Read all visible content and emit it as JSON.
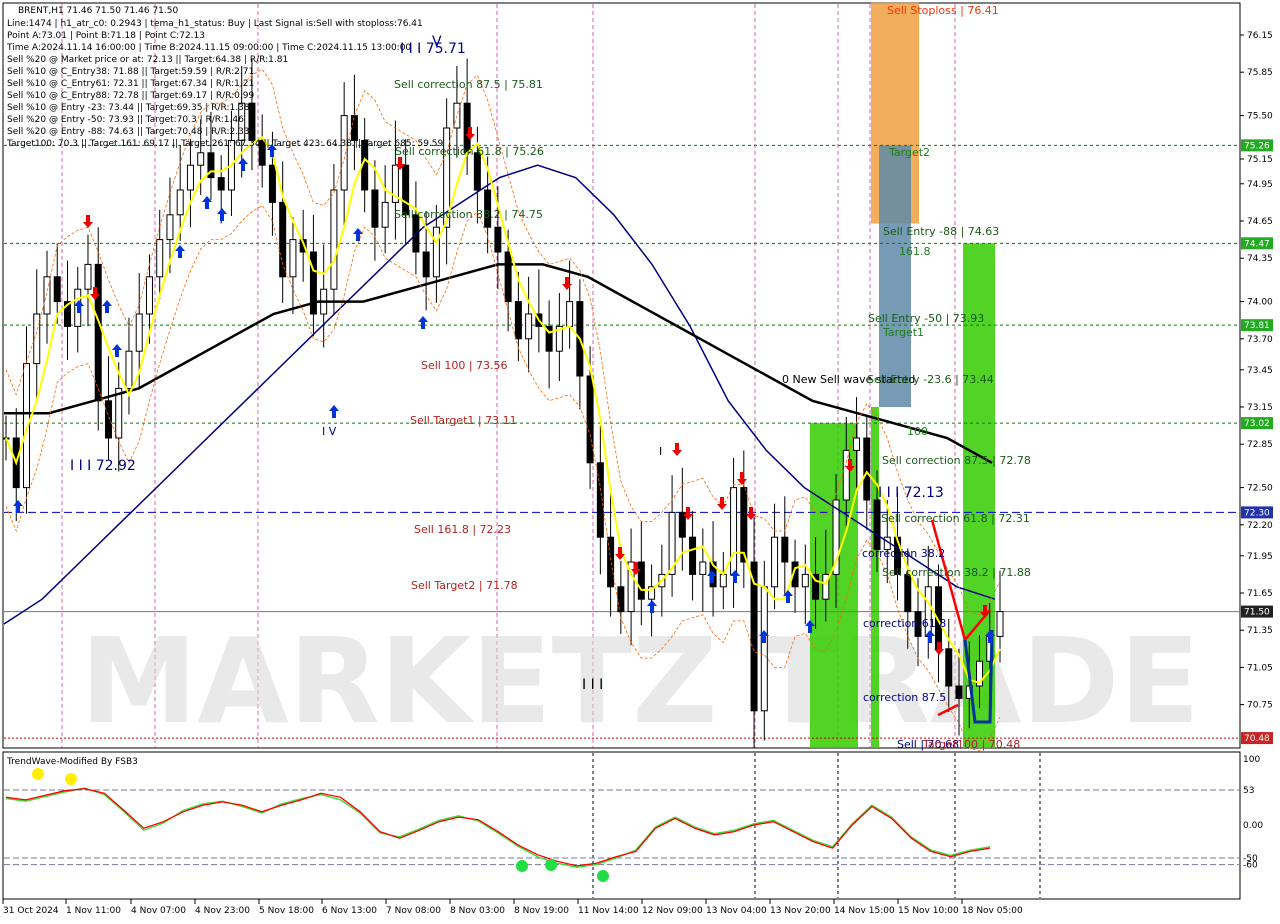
{
  "symbol_header": "BRENT,H1  71.46 71.50 71.46 71.50",
  "info_lines": [
    "Line:1474 | h1_atr_c0: 0.2943 | tema_h1_status: Buy | Last Signal is:Sell with stoploss:76.41",
    "Point A:73.01 | Point B:71.18 | Point C:72.13",
    "Time A:2024.11.14 16:00:00 | Time B:2024.11.15 09:00:00 | Time C:2024.11.15 13:00:00",
    "Sell %20 @ Market price or at: 72.13 || Target:64.38 | R/R:1.81",
    "Sell %10 @ C_Entry38: 71.88 || Target:59.59 | R/R:2.71",
    "Sell %10 @ C_Entry61: 72.31 || Target:67.34 | R/R:1.21",
    "Sell %10 @ C_Entry88: 72.78 || Target:69.17 | R/R:0.99",
    "Sell %10 @ Entry -23: 73.44 || Target:69.35 | R/R:1.38",
    "Sell %20 @ Entry -50: 73.93 || Target:70.3 | R/R:1.46",
    "Sell %20 @ Entry -88: 74.63 || Target:70.48 | R/R:2.33",
    "Target100: 70.3 || Target 161: 69.17 || Target 261: 67.34 || Target 423: 64.38 || Target 685: 59.59"
  ],
  "indicator_title": "TrendWave-Modified By FSB3",
  "watermark": "MARKETZ TRADE",
  "chart_labels": {
    "sell_stoploss": "Sell Stoploss | 76.41",
    "target2": "Target2",
    "sell_entry_88": "Sell Entry -88 | 74.63",
    "fib_1618": "161.8",
    "sell_entry_50": "Sell Entry -50 | 73.93",
    "target1": "Target1",
    "new_sell_wave": "0 New Sell wave started",
    "sell_entry_23": "Sell Entry -23.6 | 73.44",
    "fib_100": "100",
    "sell_corr_875_b": "Sell correction 87.5 | 72.78",
    "wave_iii_c": "I I I 72.13",
    "sell_corr_618_b": "Sell correction 61.8 | 72.31",
    "corr_382_short": "correction 38.2",
    "sell_corr_382_b": "Sell correction 38.2 | 71.88",
    "corr_618_short": "correction 61.8",
    "corr_875_short": "correction 87.5",
    "bottom_sell": "Sell | 70.68",
    "bottom_target": "Target100 | 70.48",
    "wave_iii_top": "I I I 75.71",
    "wave_v_top": "V",
    "sell_corr_875_a": "Sell correction 87.5 | 75.81",
    "sell_corr_618_a": "Sell correction 61.8 | 75.26",
    "sell_corr_382_a": "Sell correction 38.2 | 74.75",
    "sell_100": "Sell 100 | 73.56",
    "sell_target1": "Sell Target1 | 73.11",
    "sell_1618": "Sell 161.8 | 72.23",
    "sell_target2": "Sell Target2 | 71.78",
    "wave_iv": "I V",
    "wave_iii_left": "I I I 72.92",
    "wave_iii_mid": "I I I",
    "wave_i_mid": "I"
  },
  "colors": {
    "bull_candle": "#000000",
    "bear_candle": "#000000",
    "ema_fast": "#000080",
    "ema_slow": "#000000",
    "tema": "#ffff00",
    "envelope": "#ff6600",
    "sell_label": "#b22222",
    "green_zone": "#33cc00",
    "orange_zone": "#f0a040",
    "steelblue_zone": "#5f8aa8",
    "hline_green": "#008000",
    "hline_blue": "#0000cc",
    "osc_red": "#ff0000",
    "osc_green": "#33dd33"
  },
  "chart_data": {
    "type": "candlestick",
    "symbol": "BRENT",
    "timeframe": "H1",
    "ohlc_last": {
      "open": 71.46,
      "high": 71.5,
      "low": 71.46,
      "close": 71.5
    },
    "ylim": [
      70.4,
      76.4
    ],
    "price_ticks": [
      76.15,
      75.85,
      75.5,
      75.15,
      74.95,
      74.65,
      74.35,
      74.0,
      73.7,
      73.45,
      73.15,
      72.85,
      72.5,
      72.2,
      71.95,
      71.65,
      71.35,
      71.05,
      70.75
    ],
    "price_markers": [
      {
        "value": "75.26",
        "style": "green"
      },
      {
        "value": "74.47",
        "style": "green"
      },
      {
        "value": "73.81",
        "style": "green"
      },
      {
        "value": "73.02",
        "style": "green"
      },
      {
        "value": "72.30",
        "style": "blue"
      },
      {
        "value": "71.50",
        "style": "dark"
      },
      {
        "value": "70.48",
        "style": "red"
      }
    ],
    "h_levels": [
      {
        "value": 75.26,
        "style": "green_dotted"
      },
      {
        "value": 74.47,
        "style": "green_dotted"
      },
      {
        "value": 73.81,
        "style": "green_dotted"
      },
      {
        "value": 73.02,
        "style": "green_dotted"
      },
      {
        "value": 72.3,
        "style": "blue_dashed"
      },
      {
        "value": 71.5,
        "style": "gray_solid"
      },
      {
        "value": 70.48,
        "style": "red_dotted"
      }
    ],
    "x_labels": [
      "31 Oct 2024",
      "1 Nov 11:00",
      "4 Nov 07:00",
      "4 Nov 23:00",
      "5 Nov 18:00",
      "6 Nov 13:00",
      "7 Nov 08:00",
      "8 Nov 03:00",
      "8 Nov 19:00",
      "11 Nov 14:00",
      "12 Nov 09:00",
      "13 Nov 04:00",
      "13 Nov 20:00",
      "14 Nov 15:00",
      "15 Nov 10:00",
      "18 Nov 05:00"
    ],
    "close_path": [
      72.9,
      72.5,
      73.5,
      73.9,
      74.2,
      74.0,
      73.8,
      74.1,
      74.3,
      73.2,
      72.9,
      73.3,
      73.6,
      73.9,
      74.2,
      74.5,
      74.7,
      74.9,
      75.1,
      75.2,
      75.0,
      74.9,
      75.3,
      75.6,
      75.3,
      75.1,
      74.8,
      74.2,
      74.5,
      74.4,
      73.9,
      74.1,
      74.9,
      75.5,
      75.3,
      74.9,
      74.6,
      74.8,
      75.1,
      74.7,
      74.4,
      74.2,
      74.6,
      75.4,
      75.6,
      75.2,
      74.9,
      74.6,
      74.4,
      74.0,
      73.7,
      73.9,
      73.8,
      73.6,
      73.8,
      74.0,
      73.4,
      72.7,
      72.1,
      71.7,
      71.5,
      71.9,
      71.6,
      71.7,
      71.8,
      72.3,
      72.1,
      71.8,
      71.9,
      71.7,
      71.8,
      72.5,
      71.9,
      70.7,
      71.7,
      72.1,
      71.9,
      71.7,
      71.8,
      71.6,
      71.8,
      72.4,
      72.8,
      72.9,
      72.4,
      72.0,
      72.1,
      71.8,
      71.5,
      71.3,
      71.7,
      71.2,
      70.9,
      70.8,
      70.9,
      71.1,
      71.3,
      71.5
    ],
    "ema_fast_path": [
      71.4,
      71.6,
      71.9,
      72.2,
      72.5,
      72.8,
      73.1,
      73.4,
      73.7,
      74.0,
      74.3,
      74.6,
      74.8,
      75.0,
      75.1,
      75.0,
      74.7,
      74.3,
      73.8,
      73.2,
      72.8,
      72.5,
      72.3,
      72.1,
      71.9,
      71.7,
      71.6
    ],
    "ema_slow_path": [
      73.1,
      73.1,
      73.2,
      73.3,
      73.5,
      73.7,
      73.9,
      74.0,
      74.0,
      74.1,
      74.2,
      74.3,
      74.3,
      74.2,
      74.0,
      73.8,
      73.6,
      73.4,
      73.2,
      73.1,
      73.0,
      72.9,
      72.7
    ],
    "zones": [
      {
        "name": "stoploss",
        "from": 74.63,
        "to": 76.41,
        "color_key": "orange_zone"
      },
      {
        "name": "sell_area",
        "from": 73.15,
        "to": 75.26,
        "color_key": "steelblue_zone"
      },
      {
        "name": "green_left",
        "from": 70.4,
        "to": 73.02,
        "color_key": "green_zone"
      },
      {
        "name": "green_right",
        "from": 70.4,
        "to": 74.47,
        "color_key": "green_zone"
      }
    ],
    "oscillator": {
      "name": "TrendWave-Modified By FSB3",
      "ylim": [
        -100,
        100
      ],
      "ticks": [
        "100",
        "53",
        "0.00",
        "-50",
        "-60"
      ],
      "levels": [
        53,
        -50,
        -60
      ],
      "red_series": [
        42,
        38,
        45,
        52,
        55,
        48,
        22,
        -5,
        5,
        20,
        30,
        35,
        30,
        20,
        30,
        38,
        48,
        42,
        20,
        -10,
        -20,
        -8,
        5,
        12,
        8,
        -10,
        -30,
        -45,
        -55,
        -62,
        -58,
        -48,
        -40,
        -5,
        10,
        -5,
        -15,
        -10,
        0,
        5,
        -10,
        -25,
        -35,
        0,
        28,
        10,
        -20,
        -40,
        -48,
        -40,
        -35
      ],
      "green_series": [
        40,
        36,
        43,
        50,
        56,
        46,
        20,
        -8,
        3,
        22,
        32,
        36,
        28,
        18,
        32,
        40,
        46,
        38,
        18,
        -12,
        -18,
        -6,
        7,
        14,
        6,
        -12,
        -32,
        -48,
        -58,
        -64,
        -60,
        -50,
        -38,
        -3,
        12,
        -3,
        -13,
        -8,
        2,
        7,
        -8,
        -23,
        -33,
        2,
        30,
        12,
        -18,
        -38,
        -46,
        -38,
        -33
      ]
    }
  }
}
